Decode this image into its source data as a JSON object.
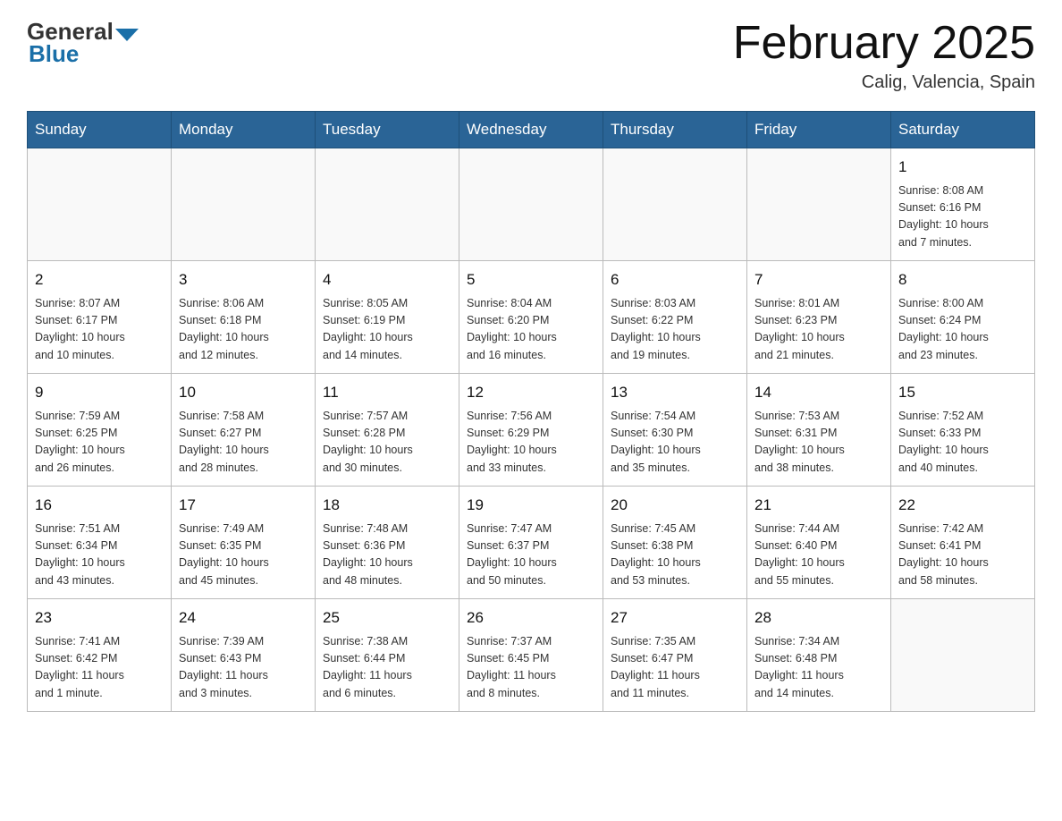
{
  "header": {
    "title": "February 2025",
    "location": "Calig, Valencia, Spain",
    "logo_general": "General",
    "logo_blue": "Blue"
  },
  "days_of_week": [
    "Sunday",
    "Monday",
    "Tuesday",
    "Wednesday",
    "Thursday",
    "Friday",
    "Saturday"
  ],
  "weeks": [
    {
      "days": [
        {
          "number": "",
          "info": ""
        },
        {
          "number": "",
          "info": ""
        },
        {
          "number": "",
          "info": ""
        },
        {
          "number": "",
          "info": ""
        },
        {
          "number": "",
          "info": ""
        },
        {
          "number": "",
          "info": ""
        },
        {
          "number": "1",
          "info": "Sunrise: 8:08 AM\nSunset: 6:16 PM\nDaylight: 10 hours\nand 7 minutes."
        }
      ]
    },
    {
      "days": [
        {
          "number": "2",
          "info": "Sunrise: 8:07 AM\nSunset: 6:17 PM\nDaylight: 10 hours\nand 10 minutes."
        },
        {
          "number": "3",
          "info": "Sunrise: 8:06 AM\nSunset: 6:18 PM\nDaylight: 10 hours\nand 12 minutes."
        },
        {
          "number": "4",
          "info": "Sunrise: 8:05 AM\nSunset: 6:19 PM\nDaylight: 10 hours\nand 14 minutes."
        },
        {
          "number": "5",
          "info": "Sunrise: 8:04 AM\nSunset: 6:20 PM\nDaylight: 10 hours\nand 16 minutes."
        },
        {
          "number": "6",
          "info": "Sunrise: 8:03 AM\nSunset: 6:22 PM\nDaylight: 10 hours\nand 19 minutes."
        },
        {
          "number": "7",
          "info": "Sunrise: 8:01 AM\nSunset: 6:23 PM\nDaylight: 10 hours\nand 21 minutes."
        },
        {
          "number": "8",
          "info": "Sunrise: 8:00 AM\nSunset: 6:24 PM\nDaylight: 10 hours\nand 23 minutes."
        }
      ]
    },
    {
      "days": [
        {
          "number": "9",
          "info": "Sunrise: 7:59 AM\nSunset: 6:25 PM\nDaylight: 10 hours\nand 26 minutes."
        },
        {
          "number": "10",
          "info": "Sunrise: 7:58 AM\nSunset: 6:27 PM\nDaylight: 10 hours\nand 28 minutes."
        },
        {
          "number": "11",
          "info": "Sunrise: 7:57 AM\nSunset: 6:28 PM\nDaylight: 10 hours\nand 30 minutes."
        },
        {
          "number": "12",
          "info": "Sunrise: 7:56 AM\nSunset: 6:29 PM\nDaylight: 10 hours\nand 33 minutes."
        },
        {
          "number": "13",
          "info": "Sunrise: 7:54 AM\nSunset: 6:30 PM\nDaylight: 10 hours\nand 35 minutes."
        },
        {
          "number": "14",
          "info": "Sunrise: 7:53 AM\nSunset: 6:31 PM\nDaylight: 10 hours\nand 38 minutes."
        },
        {
          "number": "15",
          "info": "Sunrise: 7:52 AM\nSunset: 6:33 PM\nDaylight: 10 hours\nand 40 minutes."
        }
      ]
    },
    {
      "days": [
        {
          "number": "16",
          "info": "Sunrise: 7:51 AM\nSunset: 6:34 PM\nDaylight: 10 hours\nand 43 minutes."
        },
        {
          "number": "17",
          "info": "Sunrise: 7:49 AM\nSunset: 6:35 PM\nDaylight: 10 hours\nand 45 minutes."
        },
        {
          "number": "18",
          "info": "Sunrise: 7:48 AM\nSunset: 6:36 PM\nDaylight: 10 hours\nand 48 minutes."
        },
        {
          "number": "19",
          "info": "Sunrise: 7:47 AM\nSunset: 6:37 PM\nDaylight: 10 hours\nand 50 minutes."
        },
        {
          "number": "20",
          "info": "Sunrise: 7:45 AM\nSunset: 6:38 PM\nDaylight: 10 hours\nand 53 minutes."
        },
        {
          "number": "21",
          "info": "Sunrise: 7:44 AM\nSunset: 6:40 PM\nDaylight: 10 hours\nand 55 minutes."
        },
        {
          "number": "22",
          "info": "Sunrise: 7:42 AM\nSunset: 6:41 PM\nDaylight: 10 hours\nand 58 minutes."
        }
      ]
    },
    {
      "days": [
        {
          "number": "23",
          "info": "Sunrise: 7:41 AM\nSunset: 6:42 PM\nDaylight: 11 hours\nand 1 minute."
        },
        {
          "number": "24",
          "info": "Sunrise: 7:39 AM\nSunset: 6:43 PM\nDaylight: 11 hours\nand 3 minutes."
        },
        {
          "number": "25",
          "info": "Sunrise: 7:38 AM\nSunset: 6:44 PM\nDaylight: 11 hours\nand 6 minutes."
        },
        {
          "number": "26",
          "info": "Sunrise: 7:37 AM\nSunset: 6:45 PM\nDaylight: 11 hours\nand 8 minutes."
        },
        {
          "number": "27",
          "info": "Sunrise: 7:35 AM\nSunset: 6:47 PM\nDaylight: 11 hours\nand 11 minutes."
        },
        {
          "number": "28",
          "info": "Sunrise: 7:34 AM\nSunset: 6:48 PM\nDaylight: 11 hours\nand 14 minutes."
        },
        {
          "number": "",
          "info": ""
        }
      ]
    }
  ]
}
